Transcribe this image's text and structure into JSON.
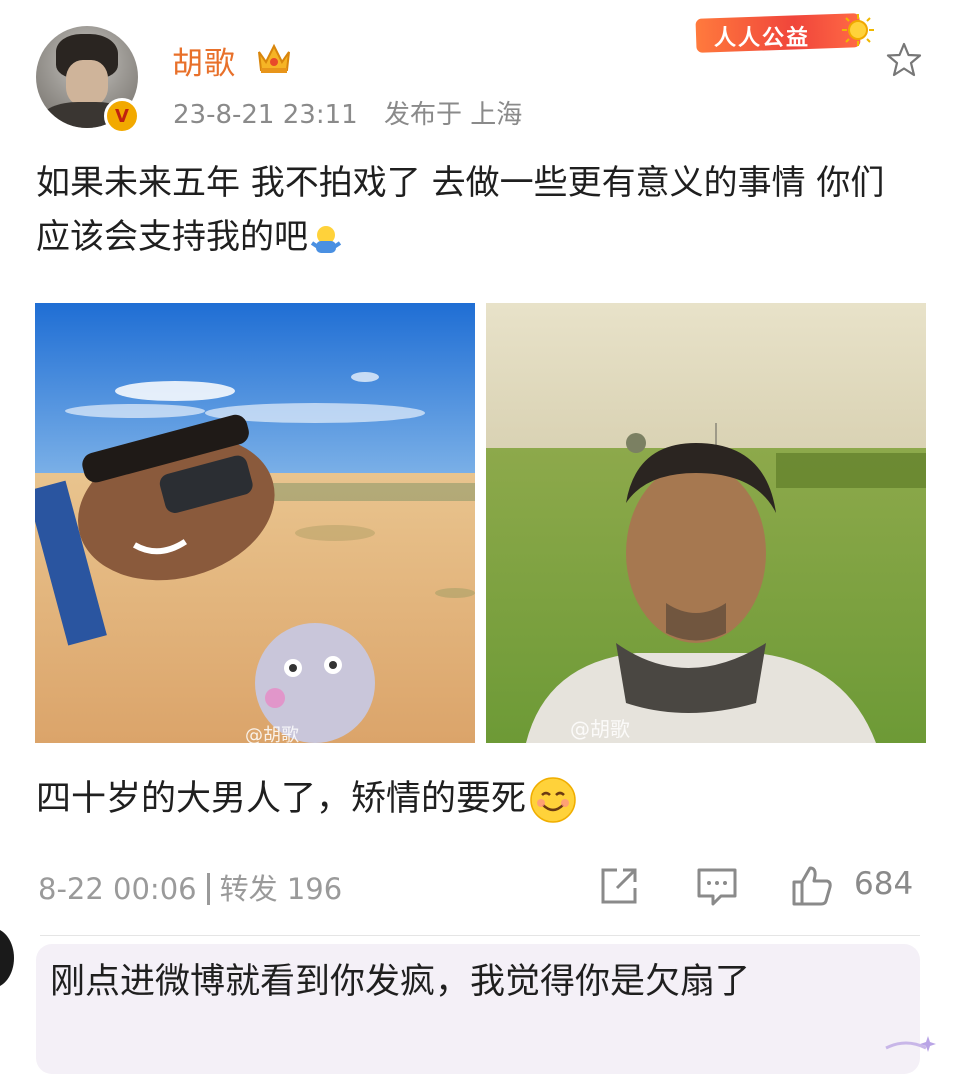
{
  "post": {
    "username": "胡歌",
    "date": "23-8-21 23:11",
    "location": "发布于 上海",
    "text": "如果未来五年 我不拍戏了 去做一些更有意义的事情 你们应该会支持我的吧",
    "badge": "人人公益",
    "images": [
      {
        "watermark": "@胡歌"
      },
      {
        "watermark": "@胡歌"
      }
    ]
  },
  "repost": {
    "comment": "四十岁的大男人了，矫情的要死",
    "date": "8-22 00:06",
    "forwards_label": "转发 196",
    "likes": "684"
  },
  "reply": {
    "text": "刚点进微博就看到你发疯，我觉得你是欠扇了"
  },
  "icons": {
    "verified": "verified-v-icon",
    "crown": "crown-icon",
    "star": "star-icon",
    "share": "share-icon",
    "comment": "comment-icon",
    "like": "thumbs-up-icon"
  },
  "colors": {
    "username": "#e8702a",
    "meta": "#8a8a8a",
    "reply_bg": "#f4f0f7"
  }
}
